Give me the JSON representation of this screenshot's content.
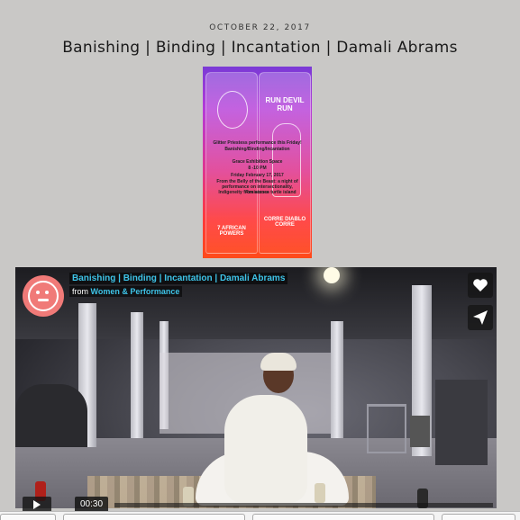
{
  "post": {
    "date": "OCTOBER 22, 2017",
    "title": "Banishing | Binding | Incantation | Damali Abrams"
  },
  "poster": {
    "left_candle_label": "7 AFRICAN POWERS",
    "right_candle_top": "RUN DEVIL RUN",
    "right_candle_bottom": "CORRE DIABLO CORRE",
    "text_lines": [
      "Glitter Priestess performance this Friday!",
      "Banishing/Binding/Incantation",
      "",
      "Grace Exhibition Space",
      "8 -10 PM",
      "Friday February 17, 2017",
      "From the Belly of the Beast: a night of",
      "performance on intersectionality, Resistance",
      "Indigeneity from across turtle island"
    ]
  },
  "video": {
    "title": "Banishing | Binding | Incantation | Damali Abrams",
    "from_label": "from",
    "source": "Women & Performance",
    "time": "00:30",
    "icons": {
      "like": "heart-icon",
      "share": "paper-plane-icon",
      "play": "play-icon",
      "logo": "smiley-logo-icon"
    },
    "colors": {
      "title_link": "#3ec4e8",
      "logo_bg": "#f07a78"
    }
  }
}
